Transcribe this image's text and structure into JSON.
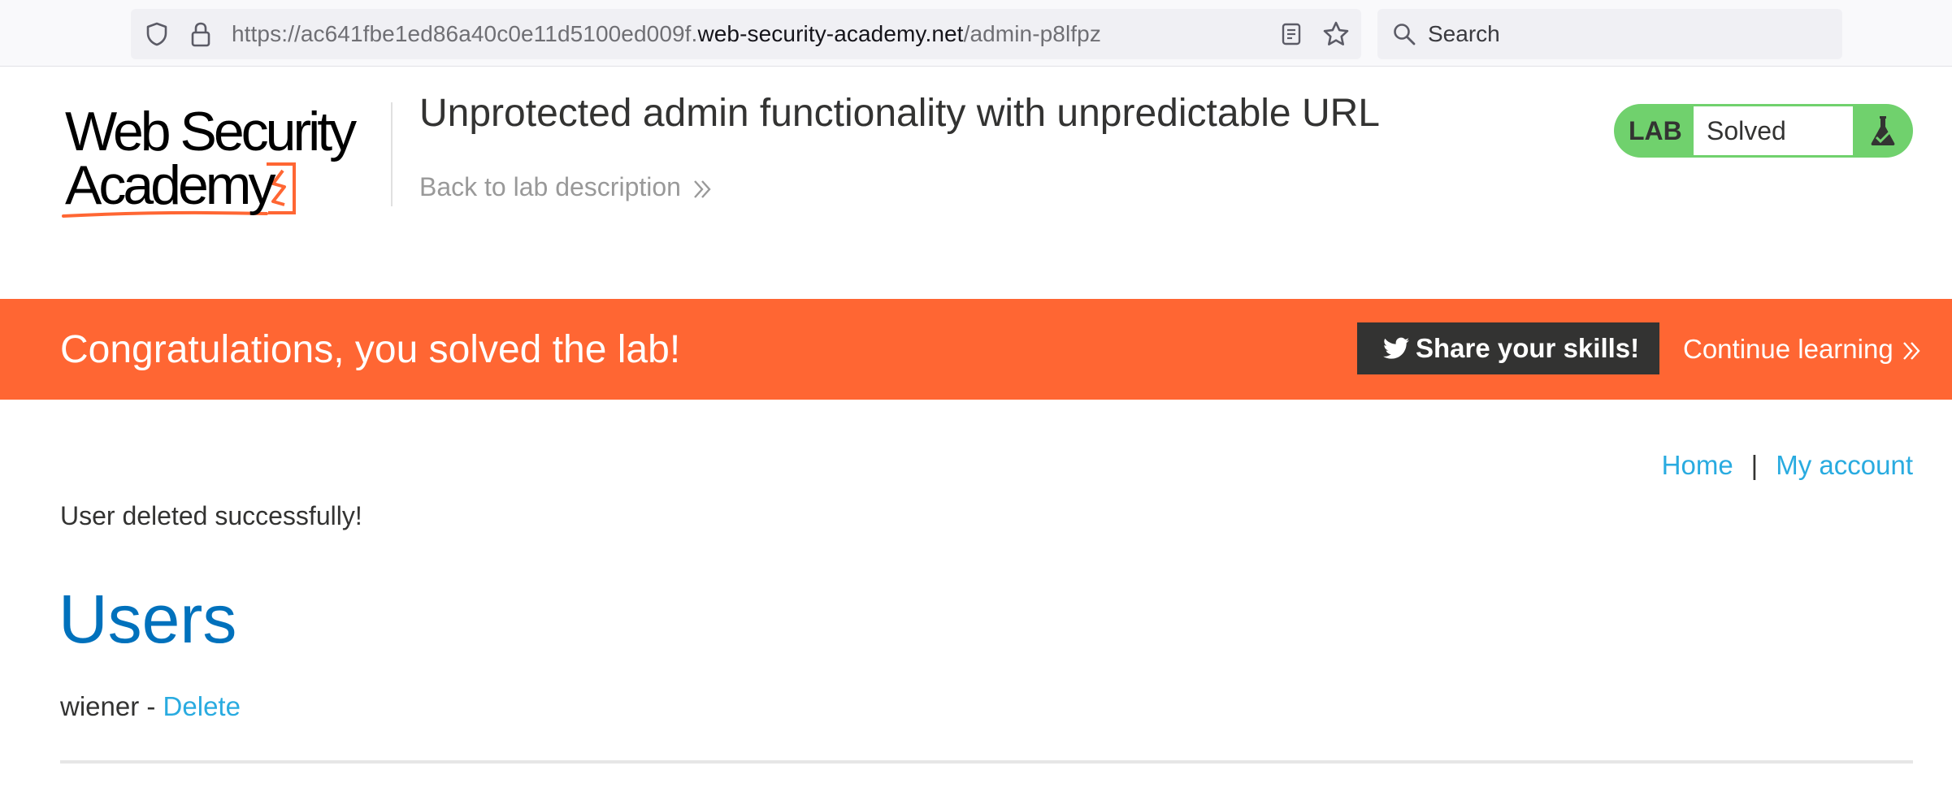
{
  "browser": {
    "url_prefix": "https://ac641fbe1ed86a40c0e11d5100ed009f.",
    "url_host": "web-security-academy.net",
    "url_path": "/admin-p8lfpz",
    "search_placeholder": "Search"
  },
  "header": {
    "logo_line1": "Web Security",
    "logo_line2": "Academy",
    "lab_title": "Unprotected admin functionality with unpredictable URL",
    "back_link": "Back to lab description",
    "lab_badge": "LAB",
    "lab_status": "Solved"
  },
  "banner": {
    "message": "Congratulations, you solved the lab!",
    "share_label": "Share your skills!",
    "continue_label": "Continue learning"
  },
  "nav": {
    "home": "Home",
    "separator": "|",
    "my_account": "My account"
  },
  "content": {
    "status_message": "User deleted successfully!",
    "heading": "Users",
    "users": [
      {
        "name": "wiener",
        "separator": " - ",
        "action": "Delete"
      }
    ]
  },
  "colors": {
    "brand_orange": "#ff6633",
    "lab_green": "#70d16d",
    "link_blue": "#29abe0",
    "heading_blue": "#0071bc",
    "dark": "#333332"
  }
}
